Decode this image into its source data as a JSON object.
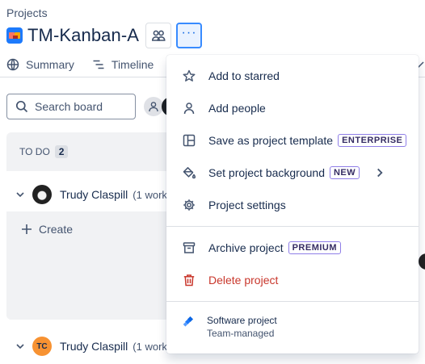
{
  "breadcrumb": "Projects",
  "project": {
    "title": "TM-Kanban-A",
    "more_label": "···"
  },
  "tabs": [
    {
      "label": "Summary",
      "icon": "globe-icon"
    },
    {
      "label": "Timeline",
      "icon": "timeline-icon"
    }
  ],
  "search": {
    "placeholder": "Search board"
  },
  "column": {
    "title": "TO DO",
    "count": "2"
  },
  "swimlanes": [
    {
      "name": "Trudy Claspill",
      "count": "(1 work",
      "avatar": "photo"
    },
    {
      "name": "Trudy Claspill",
      "count": "(1 work",
      "avatar": "TC"
    }
  ],
  "create_label": "Create",
  "menu": {
    "items": [
      {
        "label": "Add to starred",
        "icon": "star-icon"
      },
      {
        "label": "Add people",
        "icon": "person-icon"
      },
      {
        "label": "Save as project template",
        "icon": "template-icon",
        "lozenge": "ENTERPRISE"
      },
      {
        "label": "Set project background",
        "icon": "paint-bucket-icon",
        "lozenge": "NEW"
      },
      {
        "label": "Project settings",
        "icon": "gear-icon"
      },
      {
        "label": "Archive project",
        "icon": "archive-icon",
        "lozenge": "PREMIUM"
      },
      {
        "label": "Delete project",
        "icon": "trash-icon"
      }
    ],
    "footer": {
      "title": "Software project",
      "subtitle": "Team-managed"
    }
  },
  "colors": {
    "accent": "#0c66e4",
    "danger": "#c9372c",
    "lozenge_border": "#8f7ee7",
    "column_bg": "#f1f2f4",
    "tc_avatar": "#f79232"
  }
}
